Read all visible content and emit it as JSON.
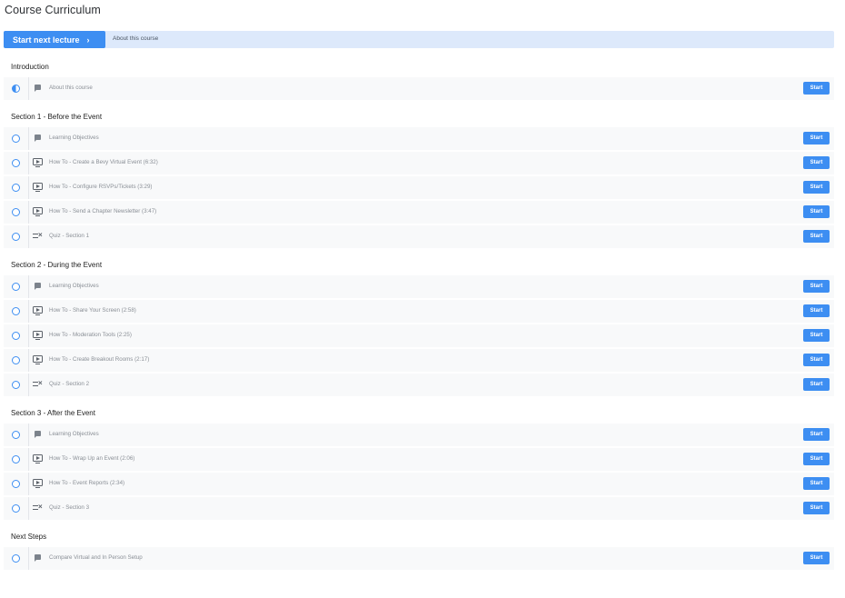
{
  "page_title": "Course Curriculum",
  "top_bar": {
    "start_next_label": "Start next lecture",
    "start_next_chevron": "›",
    "about_link": "About this course"
  },
  "colors": {
    "accent": "#3d8ef2",
    "bar_bg": "#dde9fb",
    "row_bg": "#f8f9fa"
  },
  "sections": [
    {
      "title": "Introduction",
      "items": [
        {
          "label": "About this course",
          "type": "text-icon",
          "status": "half-complete-icon",
          "button": "Start"
        }
      ]
    },
    {
      "title": "Section 1 - Before the Event",
      "items": [
        {
          "label": "Learning Objectives",
          "type": "text-icon",
          "status": "incomplete-circle-icon",
          "button": "Start"
        },
        {
          "label": "How To - Create a Bevy Virtual Event (6:32)",
          "type": "video-icon",
          "status": "incomplete-circle-icon",
          "button": "Start"
        },
        {
          "label": "How To - Configure RSVPs/Tickets (3:29)",
          "type": "video-icon",
          "status": "incomplete-circle-icon",
          "button": "Start"
        },
        {
          "label": "How To - Send a Chapter Newsletter (3:47)",
          "type": "video-icon",
          "status": "incomplete-circle-icon",
          "button": "Start"
        },
        {
          "label": "Quiz - Section 1",
          "type": "quiz-icon",
          "status": "incomplete-circle-icon",
          "button": "Start"
        }
      ]
    },
    {
      "title": "Section 2 - During the Event",
      "items": [
        {
          "label": "Learning Objectives",
          "type": "text-icon",
          "status": "incomplete-circle-icon",
          "button": "Start"
        },
        {
          "label": "How To - Share Your Screen (2:58)",
          "type": "video-icon",
          "status": "incomplete-circle-icon",
          "button": "Start"
        },
        {
          "label": "How To - Moderation Tools (2:25)",
          "type": "video-icon",
          "status": "incomplete-circle-icon",
          "button": "Start"
        },
        {
          "label": "How To - Create Breakout Rooms (2:17)",
          "type": "video-icon",
          "status": "incomplete-circle-icon",
          "button": "Start"
        },
        {
          "label": "Quiz - Section 2",
          "type": "quiz-icon",
          "status": "incomplete-circle-icon",
          "button": "Start"
        }
      ]
    },
    {
      "title": "Section 3 - After the Event",
      "items": [
        {
          "label": "Learning Objectives",
          "type": "text-icon",
          "status": "incomplete-circle-icon",
          "button": "Start"
        },
        {
          "label": "How To - Wrap Up an Event (2:06)",
          "type": "video-icon",
          "status": "incomplete-circle-icon",
          "button": "Start"
        },
        {
          "label": "How To - Event Reports (2:34)",
          "type": "video-icon",
          "status": "incomplete-circle-icon",
          "button": "Start"
        },
        {
          "label": "Quiz - Section 3",
          "type": "quiz-icon",
          "status": "incomplete-circle-icon",
          "button": "Start"
        }
      ]
    },
    {
      "title": "Next Steps",
      "items": [
        {
          "label": "Compare Virtual and In Person Setup",
          "type": "text-icon",
          "status": "incomplete-circle-icon",
          "button": "Start"
        }
      ]
    }
  ]
}
